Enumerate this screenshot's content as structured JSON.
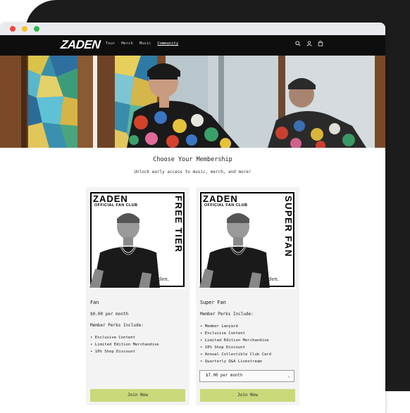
{
  "browser": {
    "dots": [
      "close",
      "minimize",
      "zoom"
    ]
  },
  "header": {
    "logo": "ZADEN",
    "nav": [
      "Tour",
      "Merch",
      "Music",
      "Community"
    ],
    "active_nav": "Community",
    "icons": [
      "search-icon",
      "account-icon",
      "cart-icon"
    ]
  },
  "membership": {
    "title": "Choose Your Membership",
    "subtitle": "Unlock early access to music, merch, and more!"
  },
  "tiers": [
    {
      "poster_brand": "ZADEN",
      "poster_sub": "OFFICIAL FAN CLUB",
      "poster_tier": "FREE TIER",
      "poster_sign": "Zaden.",
      "name": "Fan",
      "price": "$0.00 per month",
      "perks_heading": "Member Perks Include:",
      "perks": [
        "Exclusive Content",
        "Limited Edition Merchandise",
        "10% Shop Discount"
      ],
      "button": "Join Now"
    },
    {
      "poster_brand": "ZADEN",
      "poster_sub": "OFFICIAL FAN CLUB",
      "poster_tier": "SUPER FAN",
      "poster_sign": "Zaden.",
      "name": "Super Fan",
      "price_heading": "Member Perks Include:",
      "perks": [
        "Member Lanyard",
        "Exclusive Content",
        "Limited Edition Merchandise",
        "10% Shop Discount",
        "Annual Collectible Club Card",
        "Quarterly Q&A Livestream"
      ],
      "select_value": "$7.00 per month",
      "button": "Join Now"
    }
  ],
  "colors": {
    "header_bg": "#0e0e0e",
    "button_bg": "#c9d97a",
    "card_bg": "#f3f3f3",
    "frame_bg": "#1c1c1c"
  }
}
